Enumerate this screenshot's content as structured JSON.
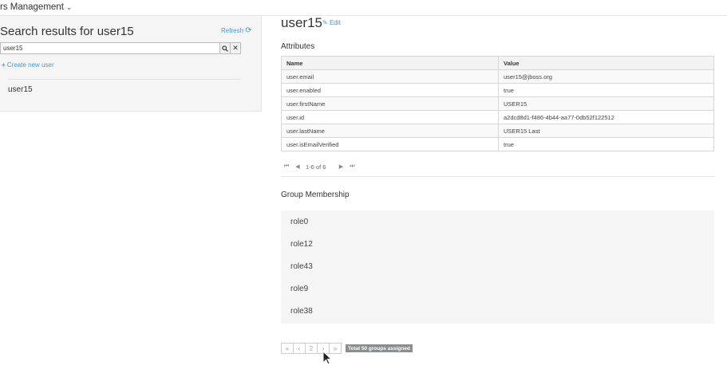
{
  "header": {
    "app_title": "rs Management"
  },
  "search_panel": {
    "title": "Search results for user15",
    "refresh_label": "Refresh",
    "search_value": "user15",
    "create_label": "Create new user",
    "results": [
      "user15"
    ]
  },
  "user": {
    "title": "user15",
    "edit_label": "Edit"
  },
  "attributes": {
    "section_title": "Attributes",
    "columns": [
      "Name",
      "Value"
    ],
    "rows": [
      [
        "user.email",
        "user15@jboss.org"
      ],
      [
        "user.enabled",
        "true"
      ],
      [
        "user.firstName",
        "USER15"
      ],
      [
        "user.id",
        "a2dcd8d1-f486-4b44-aa77-0db52f122512"
      ],
      [
        "user.lastName",
        "USER15 Last"
      ],
      [
        "user.isEmailVerified",
        "true"
      ]
    ],
    "pager_text": "1-6 of 6"
  },
  "groups": {
    "section_title": "Group Membership",
    "items": [
      "role0",
      "role12",
      "role43",
      "role9",
      "role38"
    ],
    "page_number": "2",
    "total_label": "Total 50 groups assigned"
  },
  "colors": {
    "link": "#3f9bd6",
    "panel_bg": "#f5f5f5",
    "badge_bg": "#8b8d8f"
  }
}
